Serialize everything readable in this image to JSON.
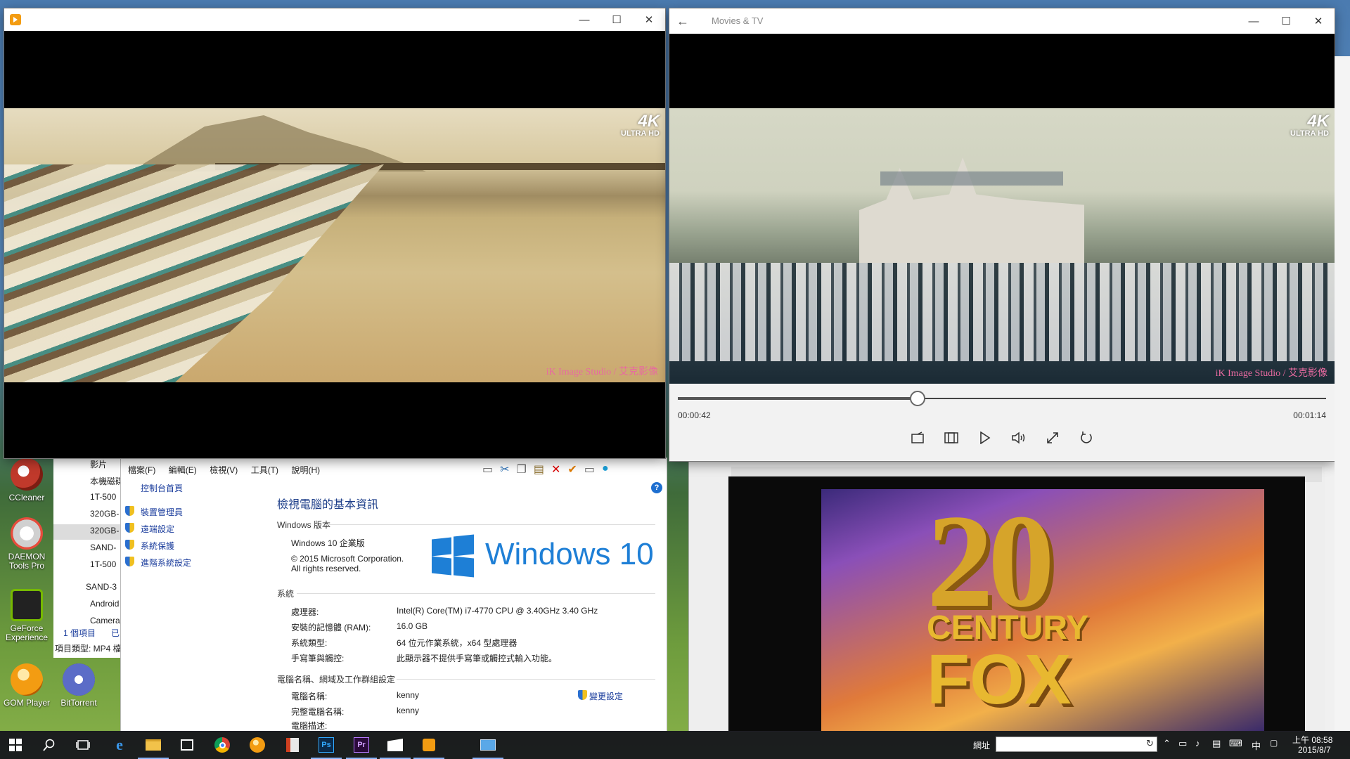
{
  "left_player": {
    "badge_4k": "4K",
    "badge_ultra": "ULTRA HD",
    "watermark": "iK Image Studio / 艾克影像"
  },
  "movies_tv": {
    "title": "Movies & TV",
    "badge_4k": "4K",
    "badge_ultra": "ULTRA HD",
    "watermark": "iK Image Studio / 艾克影像",
    "time_elapsed": "00:00:42",
    "time_total": "00:01:14",
    "progress": 0.37
  },
  "explorer_left": {
    "items": [
      "影片",
      "本機磁碟",
      "1T-500",
      "320GB-",
      "320GB-",
      "SAND-",
      "1T-500",
      "SAND-3",
      "Android",
      "Camera"
    ],
    "status_count": "1 個項目",
    "status_selected": "已",
    "status_type": "項目類型: MP4 檔"
  },
  "system_window": {
    "menu": [
      "檔案(F)",
      "編輯(E)",
      "檢視(V)",
      "工具(T)",
      "說明(H)"
    ],
    "left_links": [
      "控制台首頁",
      "裝置管理員",
      "遠端設定",
      "系統保護",
      "進階系統設定"
    ],
    "heading": "檢視電腦的基本資訊",
    "section_edition": "Windows 版本",
    "edition": "Windows 10 企業版",
    "copyright": "© 2015 Microsoft Corporation.",
    "rights": "All rights reserved.",
    "logo_text": "Windows 10",
    "section_system": "系統",
    "system_rows": [
      {
        "label": "處理器:",
        "value": "Intel(R) Core(TM) i7-4770 CPU @ 3.40GHz   3.40 GHz"
      },
      {
        "label": "安裝的記憶體 (RAM):",
        "value": "16.0 GB"
      },
      {
        "label": "系統類型:",
        "value": "64 位元作業系統，x64 型處理器"
      },
      {
        "label": "手寫筆與觸控:",
        "value": "此顯示器不提供手寫筆或觸控式輸入功能。"
      }
    ],
    "section_computer": "電腦名稱、網域及工作群組設定",
    "computer_rows": [
      {
        "label": "電腦名稱:",
        "value": "kenny"
      },
      {
        "label": "完整電腦名稱:",
        "value": "kenny"
      },
      {
        "label": "電腦描述:",
        "value": ""
      }
    ],
    "change_settings": "變更設定"
  },
  "desktop_icons": [
    {
      "label": "CCleaner",
      "color": "#c0392b"
    },
    {
      "label": "DAEMON Tools Pro",
      "color": "#e8e8e8"
    },
    {
      "label": "GeForce Experience",
      "color": "#76b900"
    },
    {
      "label": "GOM Player",
      "color": "#f39c12"
    },
    {
      "label": "BitTorrent",
      "color": "#5b6cc7"
    }
  ],
  "fox_player": {
    "logo_line1": "20",
    "logo_line2": "CENTURY",
    "logo_line3": "FOX"
  },
  "taskbar": {
    "address_label": "網址",
    "clock_time": "上午 08:58",
    "clock_date": "2015/8/7",
    "ime": "中"
  }
}
